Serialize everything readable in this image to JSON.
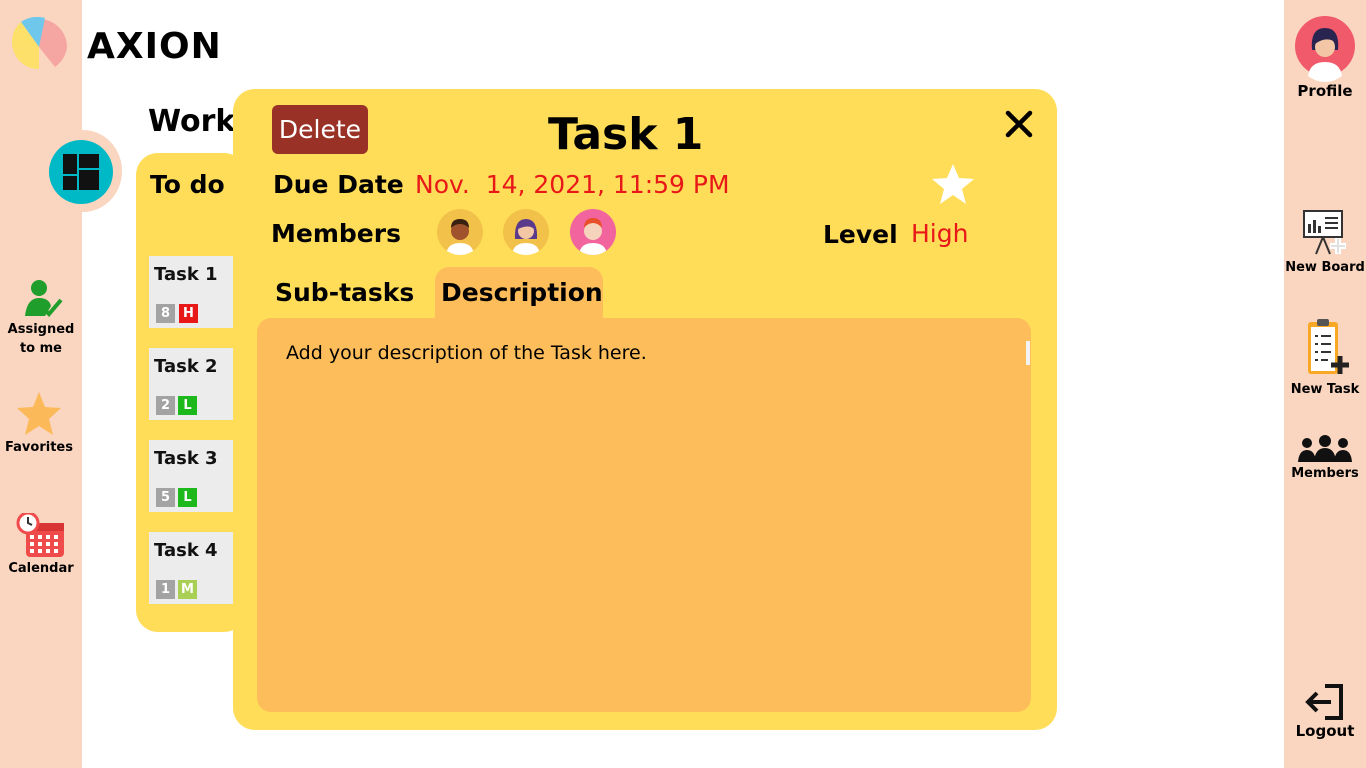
{
  "app": {
    "name": "AXION"
  },
  "sidebar_left": {
    "items": [
      {
        "label_line1": "Assigned",
        "label_line2": "to me",
        "icon": "assigned-user-icon"
      },
      {
        "label": "Favorites",
        "icon": "star-icon"
      },
      {
        "label": "Calendar",
        "icon": "calendar-icon"
      }
    ]
  },
  "sidebar_right": {
    "profile_label": "Profile",
    "new_board_label": "New Board",
    "new_task_label": "New Task",
    "members_label": "Members",
    "logout_label": "Logout"
  },
  "board": {
    "title": "Work",
    "column_title": "To do",
    "tasks": [
      {
        "name": "Task 1",
        "count": "8",
        "level": "H",
        "level_color": "#e81818"
      },
      {
        "name": "Task 2",
        "count": "2",
        "level": "L",
        "level_color": "#1cb81c"
      },
      {
        "name": "Task 3",
        "count": "5",
        "level": "L",
        "level_color": "#1cb81c"
      },
      {
        "name": "Task 4",
        "count": "1",
        "level": "M",
        "level_color": "#a9cf54"
      }
    ]
  },
  "modal": {
    "delete_label": "Delete",
    "title": "Task 1",
    "due_label": "Due Date",
    "due_value": "Nov.  14, 2021, 11:59 PM",
    "members_label": "Members",
    "level_label": "Level",
    "level_value": "High",
    "tabs": {
      "subtasks": "Sub-tasks",
      "description": "Description"
    },
    "description_text": "Add your description of the Task here."
  },
  "colors": {
    "sidebar": "#fad5bf",
    "accent_yellow": "#ffdd58",
    "accent_orange": "#fdbd5a",
    "danger": "#e81818",
    "delete_button": "#9a3126",
    "board_icon": "#00b9c6"
  }
}
